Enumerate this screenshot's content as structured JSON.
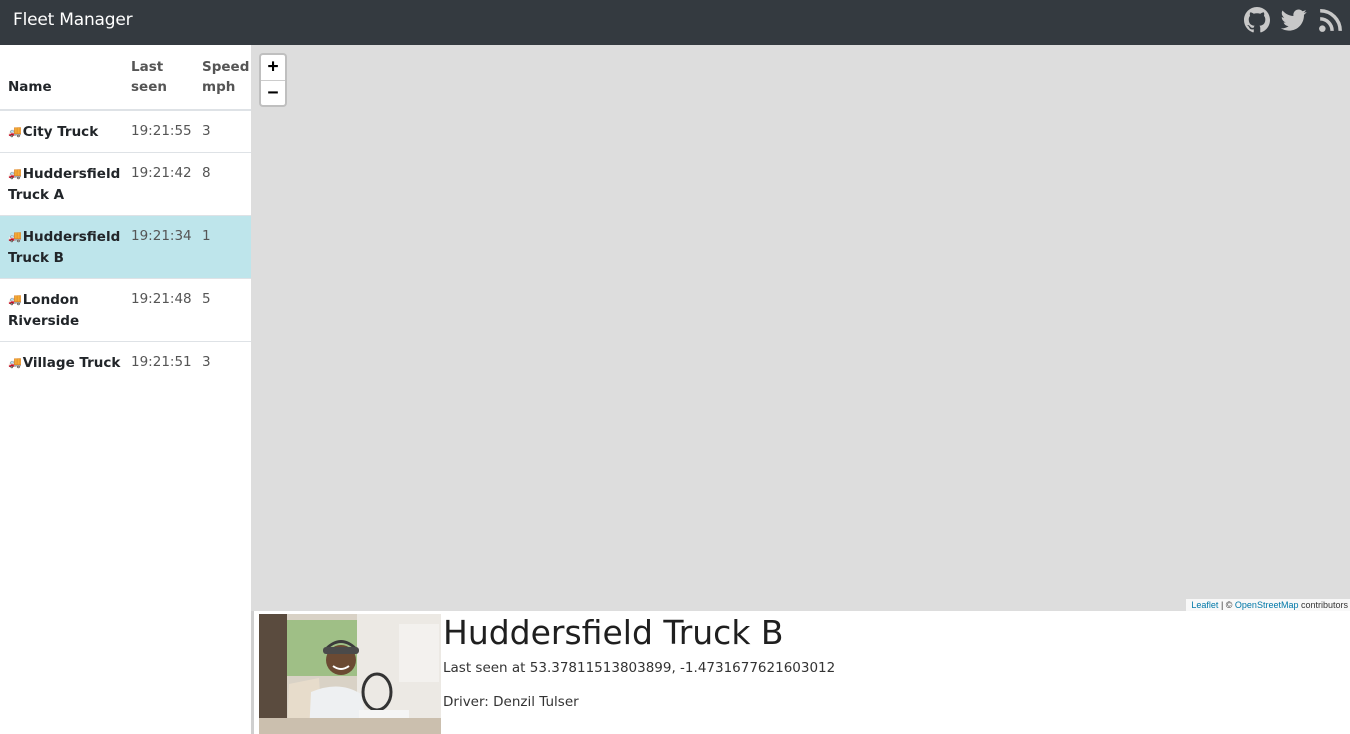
{
  "app": {
    "title": "Fleet Manager"
  },
  "nav_icons": [
    "github-icon",
    "twitter-icon",
    "rss-icon"
  ],
  "table": {
    "headers": {
      "name": "Name",
      "last_seen": "Last seen",
      "speed": "Speed mph"
    },
    "rows": [
      {
        "name": "City Truck",
        "last_seen": "19:21:55",
        "speed": "3",
        "selected": false
      },
      {
        "name": "Huddersfield Truck A",
        "last_seen": "19:21:42",
        "speed": "8",
        "selected": false
      },
      {
        "name": "Huddersfield Truck B",
        "last_seen": "19:21:34",
        "speed": "1",
        "selected": true
      },
      {
        "name": "London Riverside",
        "last_seen": "19:21:48",
        "speed": "5",
        "selected": false
      },
      {
        "name": "Village Truck",
        "last_seen": "19:21:51",
        "speed": "3",
        "selected": false
      }
    ]
  },
  "map": {
    "zoom_in": "+",
    "zoom_out": "−",
    "attribution_leaflet": "Leaflet",
    "attribution_sep": " | © ",
    "attribution_osm": "OpenStreetMap",
    "attribution_tail": " contributors"
  },
  "details": {
    "title": "Huddersfield Truck B",
    "last_seen": "Last seen at 53.37811513803899, -1.4731677621603012",
    "driver": "Driver: Denzil Tulser"
  },
  "colors": {
    "navbar": "#343a40",
    "selected_row": "#bee5eb",
    "map_bg": "#dddddd",
    "link": "#0078a8"
  }
}
